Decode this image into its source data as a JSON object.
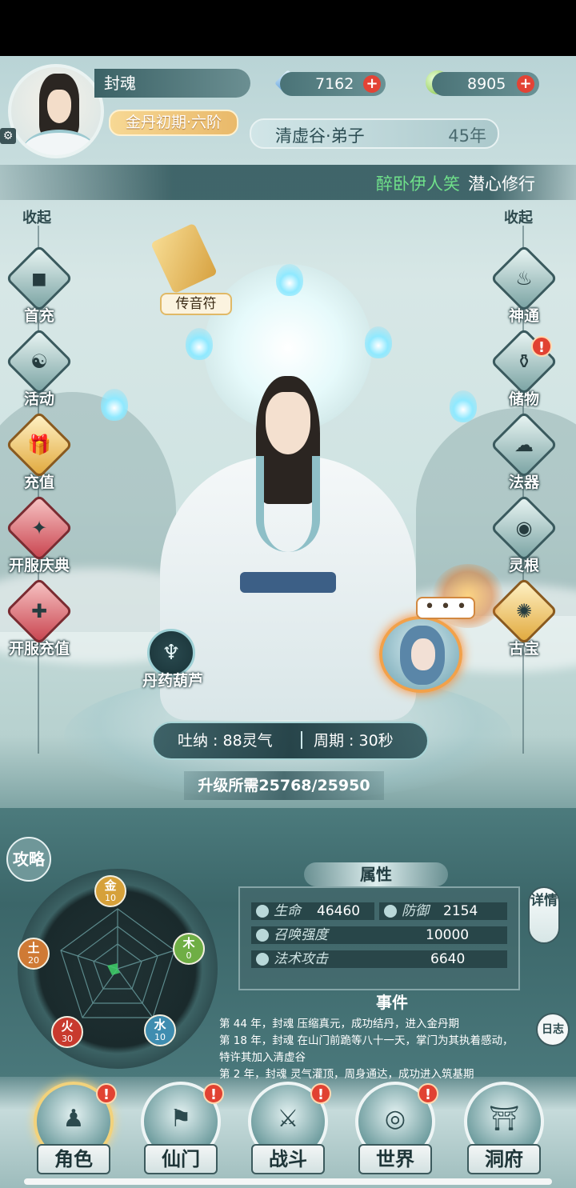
{
  "player": {
    "name": "封魂",
    "realm": "金丹初期·六阶",
    "sect": "清虚谷·弟子",
    "age": "45年"
  },
  "resources": {
    "crystal": "7162",
    "jade": "8905",
    "plus": "+"
  },
  "marquee": {
    "who": "醉卧伊人笑",
    "what": "潜心修行"
  },
  "left_menu": {
    "collapse": "收起",
    "items": [
      {
        "label": "首充",
        "icon": "square-coin-icon"
      },
      {
        "label": "活动",
        "icon": "taiji-icon"
      },
      {
        "label": "充值",
        "icon": "gift-icon"
      },
      {
        "label": "开服庆典",
        "icon": "celebration-icon"
      },
      {
        "label": "开服充值",
        "icon": "money-bag-icon"
      }
    ]
  },
  "right_menu": {
    "collapse": "收起",
    "items": [
      {
        "label": "神通",
        "icon": "flame-spirit-icon"
      },
      {
        "label": "储物",
        "icon": "storage-jar-icon"
      },
      {
        "label": "法器",
        "icon": "magic-tool-icon"
      },
      {
        "label": "灵根",
        "icon": "spirit-root-icon"
      },
      {
        "label": "古宝",
        "icon": "ancient-treasure-icon"
      }
    ]
  },
  "scroll": {
    "label": "传音符"
  },
  "gourd": {
    "label": "丹药葫芦"
  },
  "npc": {
    "bubble": "• • •"
  },
  "cultivation": {
    "breath": "吐纳 : 88灵气",
    "cycle": "周期 : 30秒",
    "upgrade": "升级所需25768/25950"
  },
  "guide": {
    "label": "攻略"
  },
  "elements": [
    {
      "name": "金",
      "value": "10",
      "color": "#d6a13a"
    },
    {
      "name": "木",
      "value": "0",
      "color": "#6fae45"
    },
    {
      "name": "水",
      "value": "10",
      "color": "#3f8db0"
    },
    {
      "name": "火",
      "value": "30",
      "color": "#c83a2e"
    },
    {
      "name": "土",
      "value": "20",
      "color": "#cf7a35"
    }
  ],
  "attributes": {
    "title": "属性",
    "hp_label": "生命",
    "hp": "46460",
    "def_label": "防御",
    "def": "2154",
    "summon_label": "召唤强度",
    "summon": "10000",
    "magic_label": "法术攻击",
    "magic": "6640",
    "detail": "详情"
  },
  "events": {
    "title": "事件",
    "lines": [
      "第 44 年，封魂 压缩真元，成功结丹，进入金丹期",
      "第 18 年，封魂 在山门前跪等八十一天，掌门为其执着感动，",
      "特许其加入清虚谷",
      "第 2 年，封魂 灵气灌顶，周身通达，成功进入筑基期"
    ],
    "log": "日志"
  },
  "nav": [
    {
      "label": "角色",
      "icon": "character-icon",
      "alert": "!"
    },
    {
      "label": "仙门",
      "icon": "sect-banner-icon",
      "alert": "!"
    },
    {
      "label": "战斗",
      "icon": "sword-icon",
      "alert": "!"
    },
    {
      "label": "世界",
      "icon": "world-icon",
      "alert": "!"
    },
    {
      "label": "洞府",
      "icon": "cave-pavilion-icon",
      "alert": ""
    }
  ],
  "alerts": {
    "storage": "!"
  }
}
